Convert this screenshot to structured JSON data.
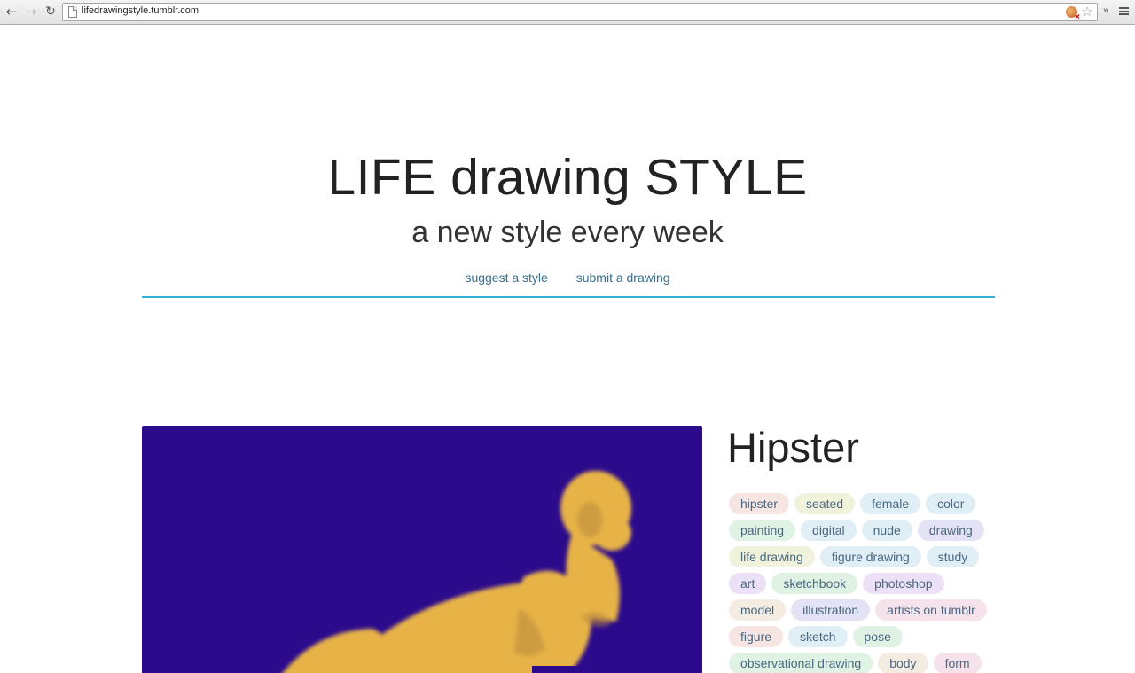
{
  "browser": {
    "url": "lifedrawingstyle.tumblr.com"
  },
  "site": {
    "title": "LIFE drawing STYLE",
    "subtitle": "a new style every week",
    "nav": [
      "suggest a style",
      "submit a drawing"
    ],
    "accent_color": "#34b1d9"
  },
  "post": {
    "title": "Hipster",
    "image_background": "#2c0a8c",
    "figure_color": "#e7b347",
    "tags": [
      [
        "hipster",
        "seated",
        "female",
        "color"
      ],
      [
        "painting",
        "digital",
        "nude",
        "drawing"
      ],
      [
        "life drawing",
        "figure drawing",
        "study"
      ],
      [
        "art",
        "sketchbook",
        "photoshop"
      ],
      [
        "model",
        "illustration",
        "artists on tumblr"
      ],
      [
        "figure",
        "sketch",
        "pose"
      ],
      [
        "observational drawing",
        "body",
        "form"
      ]
    ]
  }
}
